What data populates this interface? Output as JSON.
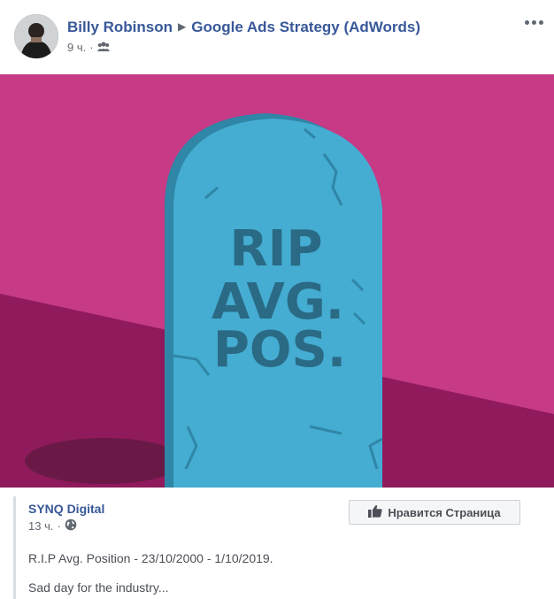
{
  "post": {
    "author": "Billy Robinson",
    "group": "Google Ads Strategy (AdWords)",
    "time": "9 ч.",
    "privacy_icon": "group-icon",
    "more_icon": "more-dots-icon"
  },
  "image": {
    "text_line1": "RIP",
    "text_line2": "AVG.",
    "text_line3": "POS.",
    "colors": {
      "background": "#c63a86",
      "shadow": "#8f1a5c",
      "stone": "#45acd2",
      "stone_dark": "#2f86a6",
      "text": "#2a6a84"
    }
  },
  "shared": {
    "page_name": "SYNQ Digital",
    "time": "13 ч.",
    "privacy_icon": "globe-icon",
    "like_page_label": "Нравится Страница",
    "lines": [
      "R.I.P Avg. Position - 23/10/2000 - 1/10/2019.",
      "Sad day for the industry..."
    ]
  }
}
